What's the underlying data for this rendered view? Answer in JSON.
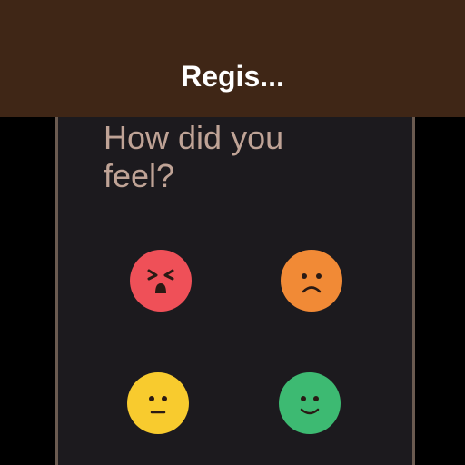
{
  "app_bar": {
    "title": "Regis..."
  },
  "survey": {
    "question": "How did you feel?",
    "moods": [
      {
        "icon": "angry-face-icon",
        "color": "#ef5058"
      },
      {
        "icon": "sad-face-icon",
        "color": "#f18a36"
      },
      {
        "icon": "neutral-face-icon",
        "color": "#f8cb2e"
      },
      {
        "icon": "happy-face-icon",
        "color": "#3dba72"
      }
    ]
  },
  "colors": {
    "app_bar_bg": "#3f2616",
    "card_bg": "#1c1a1e",
    "question_text": "#bfa396",
    "face_feature": "#2a1a14"
  }
}
